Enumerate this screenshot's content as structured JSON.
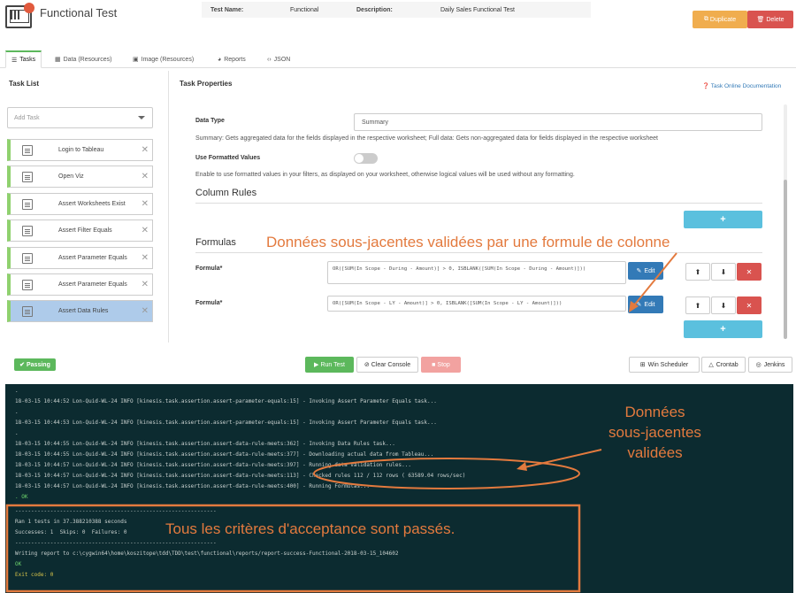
{
  "header": {
    "app_title": "Functional Test",
    "test_name_label": "Test Name:",
    "test_name_value": "Functional",
    "description_label": "Description:",
    "description_value": "Daily Sales Functional Test",
    "duplicate_label": "Duplicate",
    "delete_label": "Delete"
  },
  "tabs": [
    {
      "label": "Tasks",
      "icon": "list-icon"
    },
    {
      "label": "Data (Resources)",
      "icon": "table-icon"
    },
    {
      "label": "Image (Resources)",
      "icon": "image-icon"
    },
    {
      "label": "Reports",
      "icon": "chart-icon"
    },
    {
      "label": "JSON",
      "icon": "code-icon"
    }
  ],
  "task_list": {
    "heading": "Task List",
    "add_placeholder": "Add Task",
    "items": [
      {
        "label": "Login to Tableau"
      },
      {
        "label": "Open Viz"
      },
      {
        "label": "Assert Worksheets Exist"
      },
      {
        "label": "Assert Filter Equals"
      },
      {
        "label": "Assert Parameter Equals"
      },
      {
        "label": "Assert Parameter Equals"
      },
      {
        "label": "Assert Data Rules"
      }
    ]
  },
  "properties": {
    "heading": "Task Properties",
    "doc_link": "Task Online Documentation",
    "data_type_label": "Data Type",
    "data_type_value": "Summary",
    "data_type_help": "Summary: Gets aggregated data for the fields displayed in the respective worksheet; Full data: Gets non-aggregated data for fields displayed in the respective worksheet",
    "formatted_label": "Use Formatted Values",
    "formatted_help": "Enable to use formatted values in your filters, as displayed on your worksheet, otherwise logical values will be used without any formatting.",
    "column_rules_heading": "Column Rules",
    "formulas_heading": "Formulas",
    "formula_label": "Formula*",
    "formulas": [
      "OR([SUM(In Scope - During - Amount)] > 0, ISBLANK([SUM(In Scope - During - Amount)]))",
      "OR([SUM(In Scope - LY - Amount)] > 0, ISBLANK([SUM(In Scope - LY - Amount)]))"
    ],
    "edit_label": "Edit",
    "add_symbol": "+",
    "remove_symbol": "✕",
    "move_symbol": "⬍"
  },
  "actions": {
    "passing": "Passing",
    "run": "Run Test",
    "clear": "Clear Console",
    "stop": "Stop",
    "win_scheduler": "Win Scheduler",
    "crontab": "Crontab",
    "jenkins": "Jenkins"
  },
  "console": {
    "lines": [
      ".",
      "18-03-15 10:44:52 Lon-Quid-WL-24 INFO [kinesis.task.assertion.assert-parameter-equals:15] - Invoking Assert Parameter Equals task...",
      ".",
      "18-03-15 10:44:53 Lon-Quid-WL-24 INFO [kinesis.task.assertion.assert-parameter-equals:15] - Invoking Assert Parameter Equals task...",
      ".",
      "18-03-15 10:44:55 Lon-Quid-WL-24 INFO [kinesis.task.assertion.assert-data-rule-meets:362] - Invoking Data Rules task...",
      "18-03-15 10:44:55 Lon-Quid-WL-24 INFO [kinesis.task.assertion.assert-data-rule-meets:377] - Downloading actual data from Tableau...",
      "18-03-15 10:44:57 Lon-Quid-WL-24 INFO [kinesis.task.assertion.assert-data-rule-meets:397] - Running data validation rules...",
      "18-03-15 10:44:57 Lon-Quid-WL-24 INFO [kinesis.task.assertion.assert-data-rule-meets:113] - Checked rules 112 / 112 rows ( 63589.04 rows/sec)",
      "18-03-15 10:44:57 Lon-Quid-WL-24 INFO [kinesis.task.assertion.assert-data-rule-meets:400] - Running Formulas...",
      ". OK",
      "---------------------------------------------------------------",
      "Ran 1 tests in 37.388210388 seconds",
      "Successes: 1  Skips: 0  Failures: 0",
      "---------------------------------------------------------------",
      "Writing report to c:\\cygwin64\\home\\koszitope\\tdd\\TDD\\test\\functional\\reports/report-success-Functional-2018-03-15_104602",
      "OK",
      "Exit code: 0"
    ]
  },
  "annotations": {
    "formula_callout": "Données sous-jacentes validées par une formule de colonne",
    "validated_callout_1": "Données",
    "validated_callout_2": "sous-jacentes",
    "validated_callout_3": "validées",
    "passed_callout": "Tous les critères d'acceptance sont passés."
  },
  "colors": {
    "accent_orange": "#e37a3e",
    "success": "#5cb85c",
    "danger": "#d9534f",
    "info": "#5bc0de",
    "primary": "#337ab7",
    "console_bg": "#0c2b30"
  }
}
